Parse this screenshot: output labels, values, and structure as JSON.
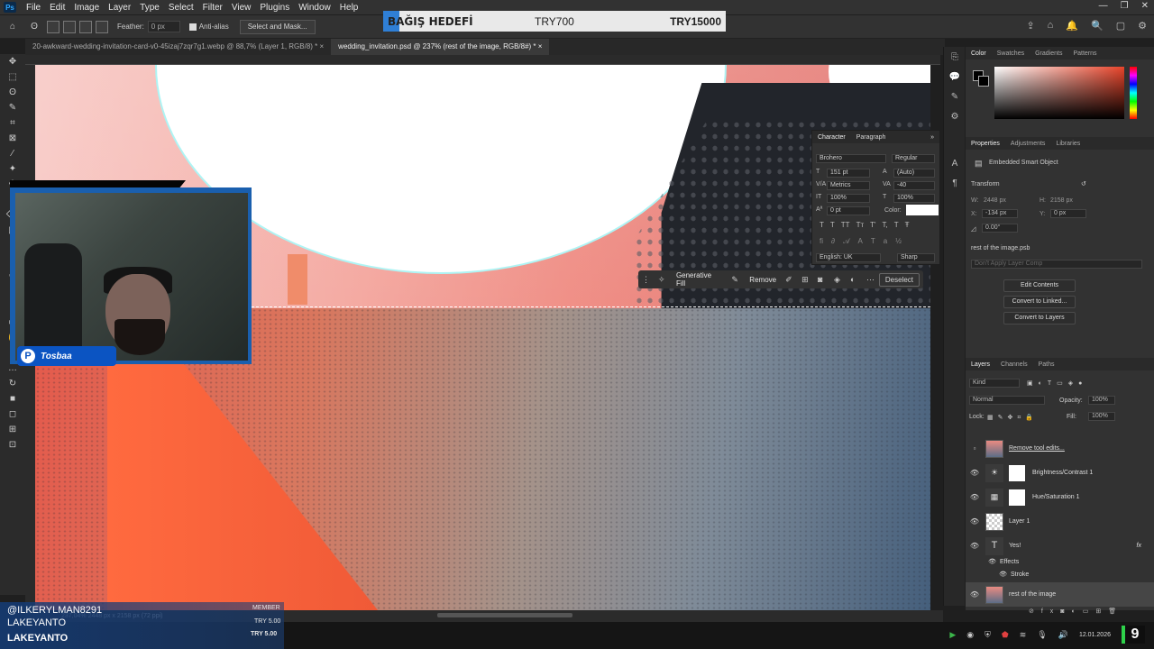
{
  "menubar": {
    "logo": "Ps",
    "items": [
      "File",
      "Edit",
      "Image",
      "Layer",
      "Type",
      "Select",
      "Filter",
      "View",
      "Plugins",
      "Window",
      "Help"
    ],
    "window_controls": [
      "—",
      "❐",
      "✕"
    ]
  },
  "donation": {
    "label": "BAĞIŞ HEDEFİ",
    "current": "TRY700",
    "goal": "TRY15000",
    "progress_fraction": 0.047,
    "fill_color": "#2f7fd6"
  },
  "options": {
    "feather_label": "Feather:",
    "feather_value": "0 px",
    "antialias_label": "Anti-alias",
    "select_mask": "Select and Mask...",
    "right_icons": [
      "⇪",
      "⌂",
      "🔔",
      "🔍",
      "▢",
      "⚙"
    ]
  },
  "tabs": [
    {
      "label": "20-awkward-wedding-invitation-card-v0-45izaj7zqr7g1.webp @ 88,7% (Layer 1, RGB/8) * ×",
      "active": false
    },
    {
      "label": "wedding_invitation.psd @ 237% (rest of the image, RGB/8#) * ×",
      "active": true
    }
  ],
  "tools": [
    "✥",
    "⬚",
    "ʘ",
    "✎",
    "⌗",
    "⊠",
    "⁄",
    "✦",
    "✚",
    "♁",
    "⌫",
    "▣",
    "◐",
    "▲",
    "✒",
    "T",
    "➚",
    "▭",
    "✋",
    "⚲",
    "…",
    "↻",
    "■",
    "◻",
    "⊞",
    "⊡"
  ],
  "character_panel": {
    "tabs": [
      "Character",
      "Paragraph"
    ],
    "font": "Brohero",
    "style": "Regular",
    "size": "151 pt",
    "leading": "(Auto)",
    "kerning": "Metrics",
    "tracking": "-40",
    "vscale": "100%",
    "hscale": "100%",
    "baseline": "0 pt",
    "color_label": "Color:",
    "language": "English: UK",
    "antialias": "Sharp",
    "type_buttons": [
      "T",
      "T",
      "TT",
      "Tт",
      "T'",
      "T,",
      "T",
      "Ŧ"
    ]
  },
  "taskbar": {
    "generative_fill": "Generative Fill",
    "remove": "Remove",
    "deselect": "Deselect"
  },
  "right_panel": {
    "color_tabs": [
      "Color",
      "Swatches",
      "Gradients",
      "Patterns"
    ],
    "prop_tabs": [
      "Properties",
      "Adjustments",
      "Libraries"
    ],
    "smart_object": "Embedded Smart Object",
    "transform_label": "Transform",
    "w_label": "W:",
    "w_value": "2448 px",
    "h_label": "H:",
    "h_value": "2158 px",
    "x_label": "X:",
    "x_value": "-134 px",
    "y_label": "Y:",
    "y_value": "0 px",
    "angle": "0.00°",
    "linked_file": "rest of the image.psb",
    "layer_comp": "Don't Apply Layer Comp",
    "buttons": [
      "Edit Contents",
      "Convert to Linked...",
      "Convert to Layers"
    ],
    "layer_tabs": [
      "Layers",
      "Channels",
      "Paths"
    ],
    "kind": "Kind",
    "blend_mode": "Normal",
    "opacity_label": "Opacity:",
    "opacity": "100%",
    "lock_label": "Lock:",
    "fill_label": "Fill:",
    "fill": "100%",
    "layers": [
      {
        "name": "Remove tool edits...",
        "thumb": "photo",
        "visible": false
      },
      {
        "name": "Brightness/Contrast 1",
        "thumb": "adj",
        "icon": "☀",
        "visible": true
      },
      {
        "name": "Hue/Saturation 1",
        "thumb": "adj",
        "icon": "▦",
        "visible": true
      },
      {
        "name": "Layer 1",
        "thumb": "trans",
        "visible": true
      },
      {
        "name": "Yes!",
        "thumb": "text",
        "visible": true
      }
    ],
    "effects_label": "Effects",
    "stroke_label": "Stroke",
    "selected_layer": "rest of the image"
  },
  "webcam": {
    "streamer": "Tosbaa"
  },
  "statusbar": "237,04%    2448 px x 2158 px (72 ppi)",
  "stream_overlay": {
    "user1": "@ILKERYLMAN8291",
    "user2": "LAKEYANTO",
    "user3": "LAKEYANTO",
    "member": "MEMBER",
    "amount1": "TRY 5.00",
    "amount2": "TRY 5.00"
  },
  "system_tray": {
    "date": "12.01.2026",
    "badge": "9"
  }
}
